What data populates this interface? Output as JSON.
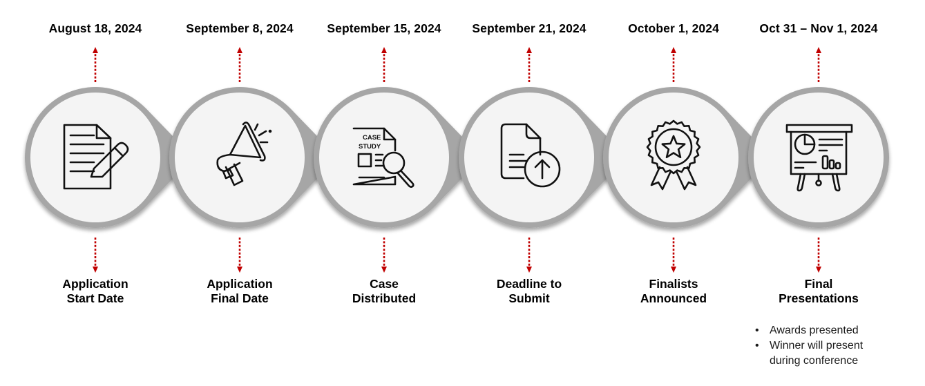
{
  "diagram": {
    "type": "timeline",
    "colors": {
      "ring": "#a6a6a6",
      "circle_fill": "#f4f4f4",
      "pointer": "#a6a6a6",
      "arrow": "#c00000",
      "text": "#000000"
    },
    "stages": [
      {
        "date": "August 18, 2024",
        "label_line1": "Application",
        "label_line2": "Start Date",
        "icon": "document-edit-icon"
      },
      {
        "date": "September 8, 2024",
        "label_line1": "Application",
        "label_line2": "Final Date",
        "icon": "megaphone-icon"
      },
      {
        "date": "September 15, 2024",
        "label_line1": "Case",
        "label_line2": "Distributed",
        "icon": "case-study-search-icon",
        "icon_text_1": "CASE",
        "icon_text_2": "STUDY"
      },
      {
        "date": "September 21, 2024",
        "label_line1": "Deadline to",
        "label_line2": "Submit",
        "icon": "document-upload-icon"
      },
      {
        "date": "October 1, 2024",
        "label_line1": "Finalists",
        "label_line2": "Announced",
        "icon": "award-ribbon-icon"
      },
      {
        "date": "Oct 31 – Nov 1, 2024",
        "label_line1": "Final",
        "label_line2": "Presentations",
        "icon": "presentation-board-icon"
      }
    ],
    "final_notes": [
      "Awards presented",
      "Winner will present during conference"
    ]
  }
}
